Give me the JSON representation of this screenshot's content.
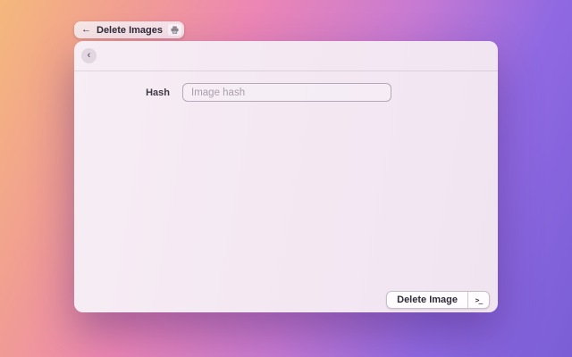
{
  "background": {
    "gradient_colors": [
      "#f5b87c",
      "#f19e92",
      "#ec86b4",
      "#c87ad2",
      "#9069e2",
      "#7a5ed6"
    ]
  },
  "breadcrumb": {
    "back_arrow": "←",
    "label": "Delete Images",
    "icon": "printer-icon"
  },
  "window": {
    "back_chevron": "‹"
  },
  "form": {
    "hash_label": "Hash",
    "hash_placeholder": "Image hash",
    "hash_value": ""
  },
  "footer": {
    "action_label": "Delete Image",
    "shortcut_glyph": ">_"
  }
}
